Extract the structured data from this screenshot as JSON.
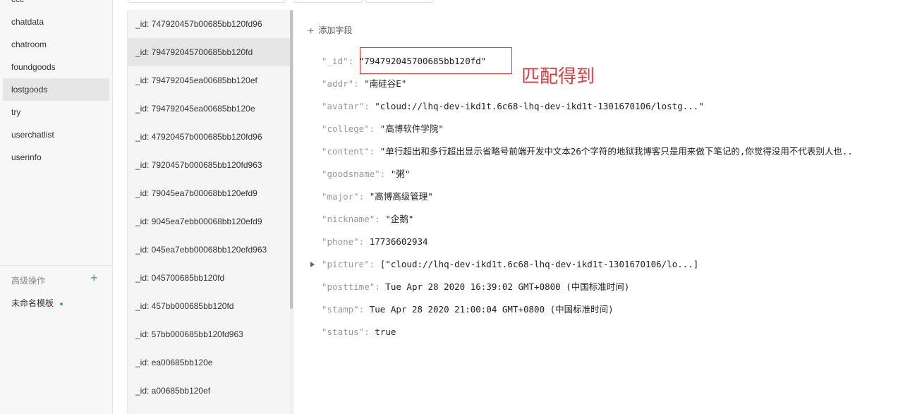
{
  "sidebar": {
    "collections": [
      {
        "label": "ccc"
      },
      {
        "label": "chatdata"
      },
      {
        "label": "chatroom"
      },
      {
        "label": "foundgoods"
      },
      {
        "label": "lostgoods",
        "active": true
      },
      {
        "label": "try"
      },
      {
        "label": "userchatlist"
      },
      {
        "label": "userinfo"
      }
    ],
    "advanced_label": "高级操作",
    "add_icon": "plus-icon",
    "template_item": "未命名模板",
    "accent_color": "#2db367"
  },
  "records": [
    {
      "label": "_id: 747920457b00685bb120fd96"
    },
    {
      "label": "_id: 794792045700685bb120fd",
      "active": true
    },
    {
      "label": "_id: 794792045ea00685bb120ef"
    },
    {
      "label": "_id: 794792045ea00685bb120e"
    },
    {
      "label": "_id: 47920457b000685bb120fd96"
    },
    {
      "label": "_id: 7920457b000685bb120fd963"
    },
    {
      "label": "_id: 79045ea7b00068bb120efd9"
    },
    {
      "label": "_id: 9045ea7ebb00068bb120efd9"
    },
    {
      "label": "_id: 045ea7ebb00068bb120efd963"
    },
    {
      "label": "_id: 045700685bb120fd"
    },
    {
      "label": "_id: 457bb000685bb120fd"
    },
    {
      "label": "_id: 57bb000685bb120fd963"
    },
    {
      "label": "_id: ea00685bb120e"
    },
    {
      "label": "_id: a00685bb120ef"
    }
  ],
  "detail": {
    "add_field_label": "添加字段",
    "fields": [
      {
        "key": "\"_id\":",
        "value": "\"794792045700685bb120fd\""
      },
      {
        "key": "\"addr\":",
        "value": "\"南硅谷E\""
      },
      {
        "key": "\"avatar\":",
        "value": "\"cloud://lhq-dev-ikd1t.6c68-lhq-dev-ikd1t-1301670106/lostg...\""
      },
      {
        "key": "\"college\":",
        "value": "\"高博软件学院\""
      },
      {
        "key": "\"content\":",
        "value": "\"单行超出和多行超出显示省略号前端开发中文本26个字符的地狱我博客只是用来做下笔记的,你觉得没用不代表别人也.."
      },
      {
        "key": "\"goodsname\":",
        "value": "\"粥\""
      },
      {
        "key": "\"major\":",
        "value": "\"高博高级管理\""
      },
      {
        "key": "\"nickname\":",
        "value": "\"企鹅\""
      },
      {
        "key": "\"phone\":",
        "value": "17736602934"
      },
      {
        "key": "\"picture\":",
        "value": "[\"cloud://lhq-dev-ikd1t.6c68-lhq-dev-ikd1t-1301670106/lo...]",
        "expandable": true
      },
      {
        "key": "\"posttime\":",
        "value": "Tue Apr 28 2020 16:39:02 GMT+0800 (中国标准时间)"
      },
      {
        "key": "\"stamp\":",
        "value": "Tue Apr 28 2020 21:00:04 GMT+0800 (中国标准时间)"
      },
      {
        "key": "\"status\":",
        "value": "true"
      }
    ]
  },
  "annotation": {
    "text": "匹配得到",
    "color": "#e03c3c"
  }
}
